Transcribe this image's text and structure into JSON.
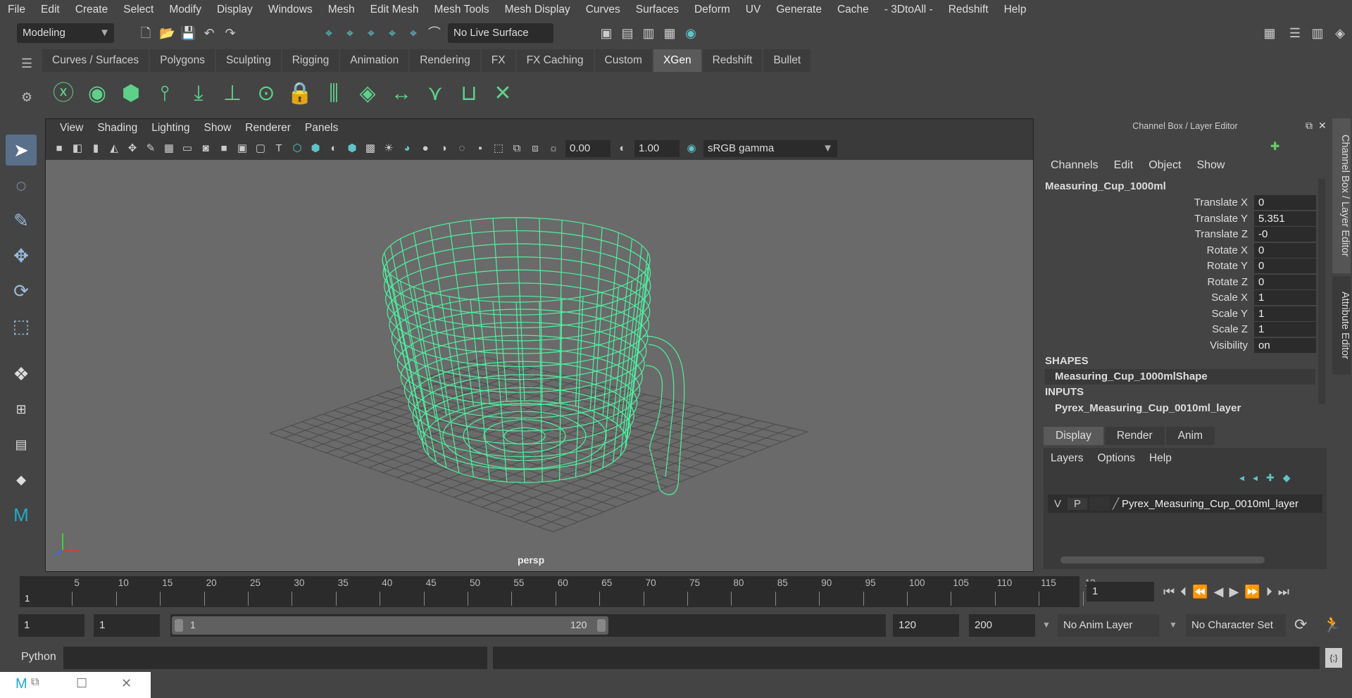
{
  "menu": [
    "File",
    "Edit",
    "Create",
    "Select",
    "Modify",
    "Display",
    "Windows",
    "Mesh",
    "Edit Mesh",
    "Mesh Tools",
    "Mesh Display",
    "Curves",
    "Surfaces",
    "Deform",
    "UV",
    "Generate",
    "Cache",
    "- 3DtoAll -",
    "Redshift",
    "Help"
  ],
  "status": {
    "mode": "Modeling",
    "live_surface": "No Live Surface"
  },
  "shelf": {
    "tabs": [
      "Curves / Surfaces",
      "Polygons",
      "Sculpting",
      "Rigging",
      "Animation",
      "Rendering",
      "FX",
      "FX Caching",
      "Custom",
      "XGen",
      "Redshift",
      "Bullet"
    ],
    "active": "XGen"
  },
  "viewport": {
    "menu": [
      "View",
      "Shading",
      "Lighting",
      "Show",
      "Renderer",
      "Panels"
    ],
    "exposure": "0.00",
    "gamma": "1.00",
    "color_space": "sRGB gamma",
    "camera": "persp"
  },
  "channel_box": {
    "title": "Channel Box / Layer Editor",
    "menu": [
      "Channels",
      "Edit",
      "Object",
      "Show"
    ],
    "object": "Measuring_Cup_1000ml",
    "attributes": [
      {
        "name": "Translate X",
        "value": "0"
      },
      {
        "name": "Translate Y",
        "value": "5.351"
      },
      {
        "name": "Translate Z",
        "value": "-0"
      },
      {
        "name": "Rotate X",
        "value": "0"
      },
      {
        "name": "Rotate Y",
        "value": "0"
      },
      {
        "name": "Rotate Z",
        "value": "0"
      },
      {
        "name": "Scale X",
        "value": "1"
      },
      {
        "name": "Scale Y",
        "value": "1"
      },
      {
        "name": "Scale Z",
        "value": "1"
      },
      {
        "name": "Visibility",
        "value": "on"
      }
    ],
    "shapes_label": "SHAPES",
    "shape": "Measuring_Cup_1000mlShape",
    "inputs_label": "INPUTS",
    "input": "Pyrex_Measuring_Cup_0010ml_layer"
  },
  "layer_editor": {
    "tabs": [
      "Display",
      "Render",
      "Anim"
    ],
    "menu": [
      "Layers",
      "Options",
      "Help"
    ],
    "layer": {
      "v": "V",
      "p": "P",
      "name": "Pyrex_Measuring_Cup_0010ml_layer"
    }
  },
  "side_tabs": [
    "Channel Box / Layer Editor",
    "Attribute Editor"
  ],
  "timeline": {
    "ticks": [
      "5",
      "10",
      "15",
      "20",
      "25",
      "30",
      "35",
      "40",
      "45",
      "50",
      "55",
      "60",
      "65",
      "70",
      "75",
      "80",
      "85",
      "90",
      "95",
      "100",
      "105",
      "110",
      "115",
      "12"
    ],
    "current_marker": "1",
    "current_frame": "1"
  },
  "range": {
    "start": "1",
    "playback_start": "1",
    "slider_start": "1",
    "slider_end": "120",
    "playback_end": "120",
    "end": "200",
    "anim_layer": "No Anim Layer",
    "character_set": "No Character Set"
  },
  "command": {
    "language": "Python"
  },
  "colors": {
    "wire": "#4ef0a0",
    "accent": "#5fc4c8",
    "bg": "#444444"
  }
}
